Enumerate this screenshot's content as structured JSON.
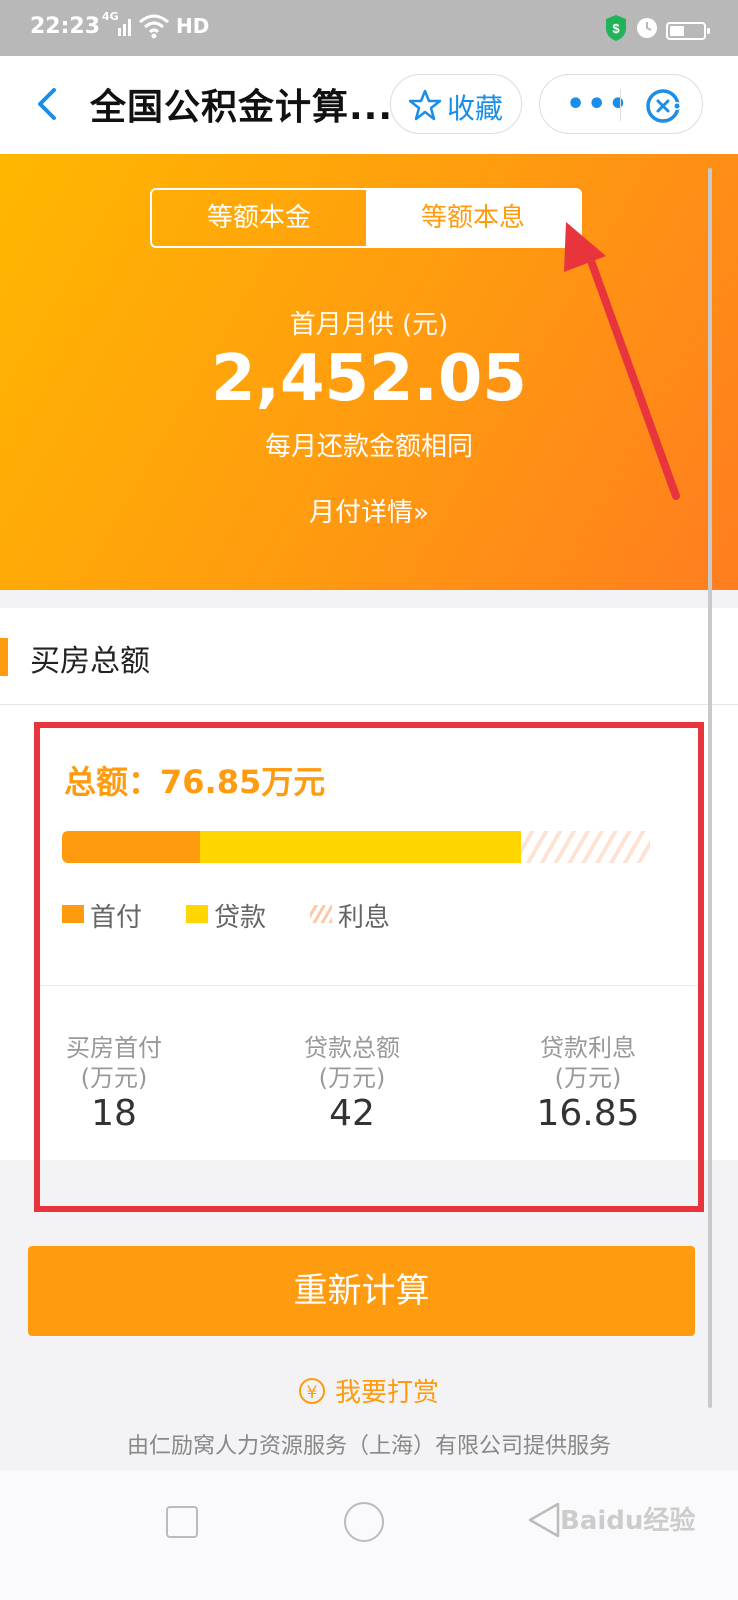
{
  "status_bar": {
    "time": "22:23",
    "network": "4G",
    "hd": "HD"
  },
  "header": {
    "title": "全国公积金计算...",
    "favorite_label": "收藏",
    "more_label": "•••"
  },
  "tabs": [
    {
      "label": "等额本金"
    },
    {
      "label": "等额本息",
      "selected": true
    }
  ],
  "summary": {
    "first_month_label": "首月月供 (元)",
    "amount": "2,452.05",
    "note": "每月还款金额相同",
    "detail_link": "月付详情»"
  },
  "section": {
    "title": "买房总额"
  },
  "breakdown": {
    "total_label": "总额：76.85万元",
    "bar_values": {
      "down_payment": 18,
      "loan": 42,
      "interest": 16.85
    },
    "legend": [
      {
        "label": "首付"
      },
      {
        "label": "贷款"
      },
      {
        "label": "利息"
      }
    ],
    "stats": [
      {
        "label": "买房首付",
        "unit": "(万元)",
        "value": "18"
      },
      {
        "label": "贷款总额",
        "unit": "(万元)",
        "value": "42"
      },
      {
        "label": "贷款利息",
        "unit": "(万元)",
        "value": "16.85"
      }
    ]
  },
  "actions": {
    "recalc_label": "重新计算",
    "reward_label": "我要打赏",
    "reward_icon_glyph": "¥"
  },
  "footer": {
    "provider": "由仁励窝人力资源服务（上海）有限公司提供服务"
  },
  "watermark": "Baidu经验",
  "colors": {
    "accent": "#ff9b0f",
    "loan": "#ffd600",
    "link": "#1a8ee8",
    "annotation": "#e8343c"
  }
}
